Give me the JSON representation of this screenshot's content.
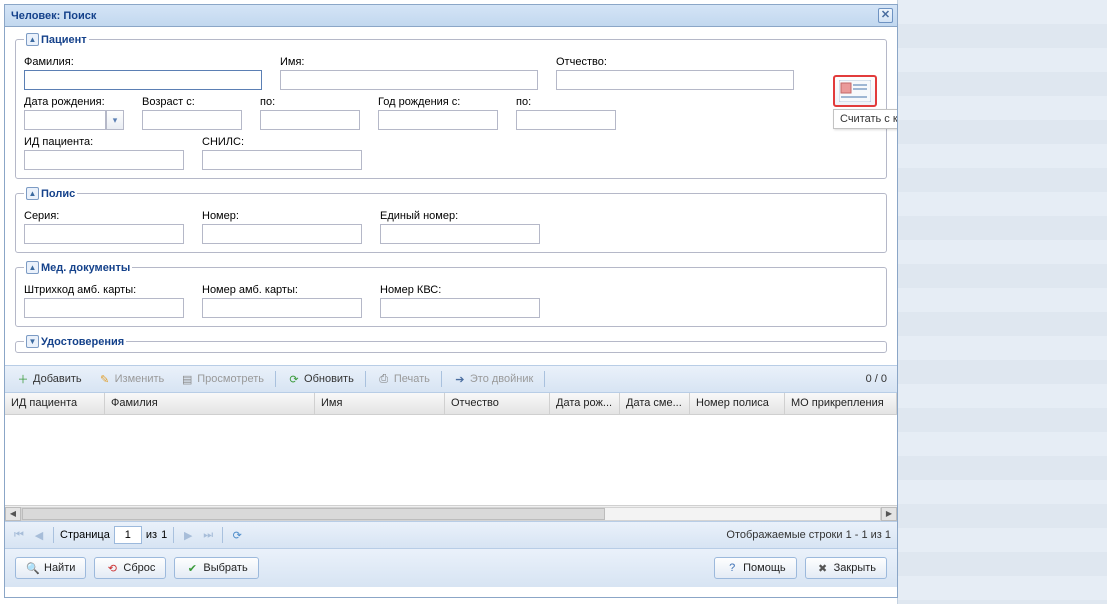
{
  "window": {
    "title": "Человек: Поиск"
  },
  "patient": {
    "legend": "Пациент",
    "lastname_label": "Фамилия:",
    "firstname_label": "Имя:",
    "middlename_label": "Отчество:",
    "birthdate_label": "Дата рождения:",
    "age_from_label": "Возраст с:",
    "age_to_label": "по:",
    "year_from_label": "Год рождения с:",
    "year_to_label": "по:",
    "id_label": "ИД пациента:",
    "snils_label": "СНИЛС:"
  },
  "polis": {
    "legend": "Полис",
    "series_label": "Серия:",
    "number_label": "Номер:",
    "unified_label": "Единый номер:"
  },
  "meddocs": {
    "legend": "Мед. документы",
    "barcode_label": "Штрихкод амб. карты:",
    "ambnum_label": "Номер амб. карты:",
    "kvs_label": "Номер КВС:"
  },
  "certs": {
    "legend": "Удостоверения"
  },
  "card_reader": {
    "tooltip": "Считать с карты"
  },
  "toolbar": {
    "add": "Добавить",
    "edit": "Изменить",
    "view": "Просмотреть",
    "refresh": "Обновить",
    "print": "Печать",
    "merge": "Это двойник",
    "counter": "0 / 0"
  },
  "grid": {
    "columns": [
      "ИД пациента",
      "Фамилия",
      "Имя",
      "Отчество",
      "Дата рож...",
      "Дата сме...",
      "Номер полиса",
      "МО прикрепления"
    ]
  },
  "pager": {
    "page_word": "Страница",
    "page_value": "1",
    "of_word": "из",
    "total_pages": "1",
    "info": "Отображаемые строки 1 - 1 из 1"
  },
  "buttons": {
    "find": "Найти",
    "reset": "Сброс",
    "select": "Выбрать",
    "help": "Помощь",
    "close": "Закрыть"
  }
}
